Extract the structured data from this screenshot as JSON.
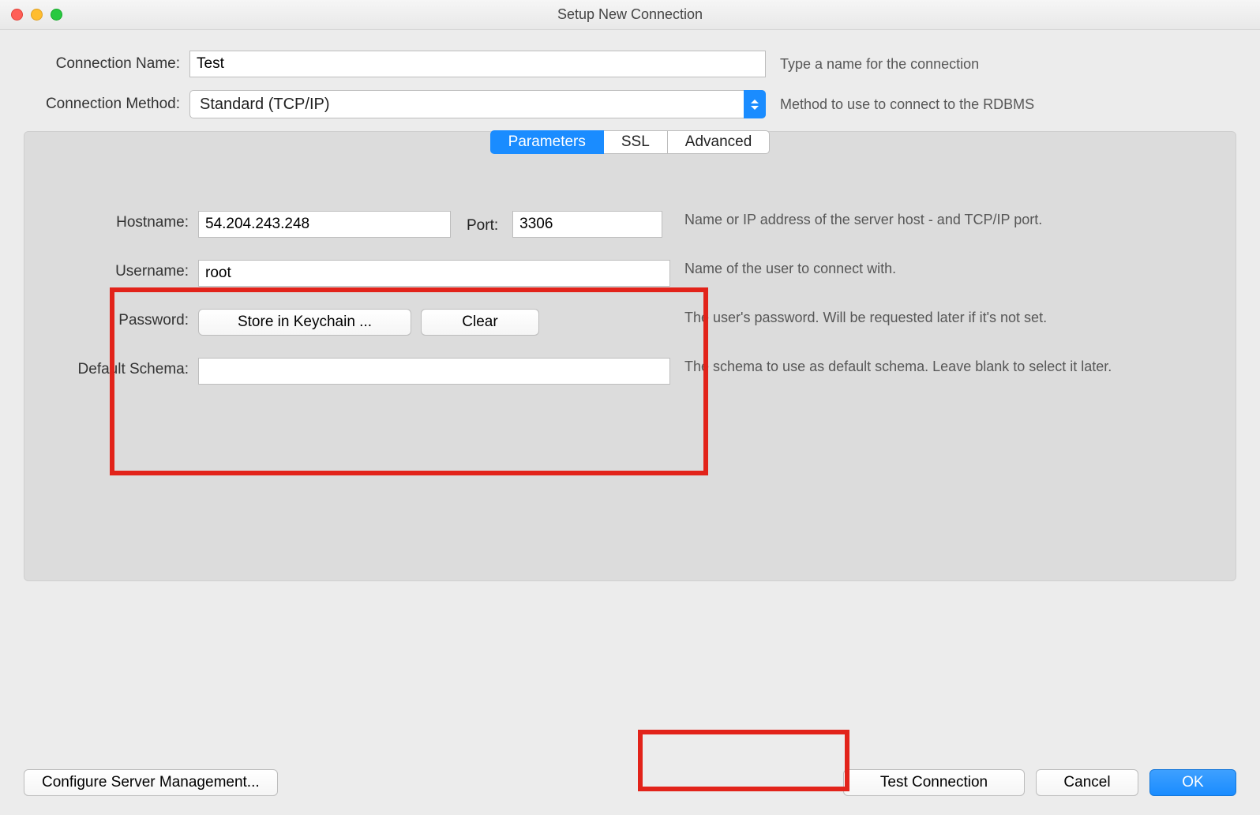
{
  "window": {
    "title": "Setup New Connection"
  },
  "top": {
    "connection_name_label": "Connection Name:",
    "connection_name_value": "Test",
    "connection_name_hint": "Type a name for the connection",
    "connection_method_label": "Connection Method:",
    "connection_method_value": "Standard (TCP/IP)",
    "connection_method_hint": "Method to use to connect to the RDBMS"
  },
  "tabs": {
    "parameters": "Parameters",
    "ssl": "SSL",
    "advanced": "Advanced"
  },
  "params": {
    "hostname_label": "Hostname:",
    "hostname_value": "54.204.243.248",
    "port_label": "Port:",
    "port_value": "3306",
    "host_hint": "Name or IP address of the server host - and TCP/IP port.",
    "username_label": "Username:",
    "username_value": "root",
    "username_hint": "Name of the user to connect with.",
    "password_label": "Password:",
    "store_btn": "Store in Keychain ...",
    "clear_btn": "Clear",
    "password_hint": "The user's password. Will be requested later if it's not set.",
    "schema_label": "Default Schema:",
    "schema_value": "",
    "schema_hint": "The schema to use as default schema. Leave blank to select it later."
  },
  "footer": {
    "configure": "Configure Server Management...",
    "test": "Test Connection",
    "cancel": "Cancel",
    "ok": "OK"
  }
}
